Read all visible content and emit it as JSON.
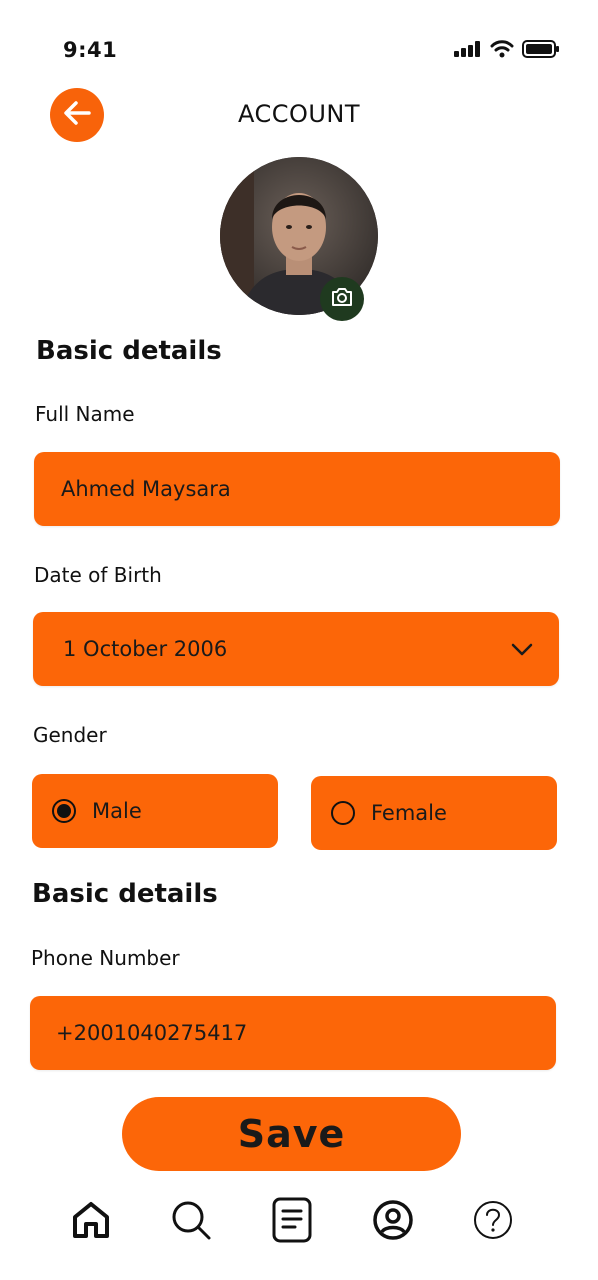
{
  "status_bar": {
    "time": "9:41"
  },
  "header": {
    "title": "ACCOUNT",
    "back_icon": "arrow-left-icon"
  },
  "profile": {
    "camera_icon": "camera-icon"
  },
  "basic_section": {
    "heading": "Basic details",
    "full_name": {
      "label": "Full Name",
      "value": "Ahmed Maysara"
    },
    "dob": {
      "label": "Date of Birth",
      "value": "1 October 2006"
    },
    "gender": {
      "label": "Gender",
      "options": [
        "Male",
        "Female"
      ],
      "selected": "Male"
    }
  },
  "contact_section": {
    "heading": "Basic details",
    "phone": {
      "label": "Phone Number",
      "value": "+2001040275417"
    }
  },
  "save_button": {
    "label": "Save"
  },
  "colors": {
    "accent": "#fc6608",
    "camera_badge": "#1f3a1f",
    "text": "#111111"
  },
  "tab_bar": {
    "items": [
      "home-icon",
      "search-icon",
      "document-icon",
      "profile-icon",
      "help-icon"
    ]
  }
}
